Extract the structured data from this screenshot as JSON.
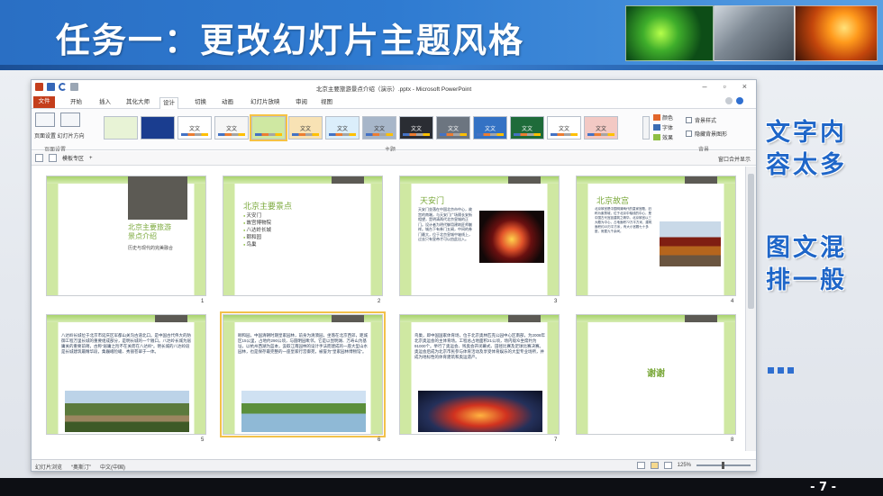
{
  "slide": {
    "title": "任务一：更改幻灯片主题风格",
    "page_number": "- 7 -",
    "annotations": {
      "text_content": [
        "文字内",
        "容太多"
      ],
      "layout": [
        "图文混",
        "排一般"
      ],
      "dots": "..."
    }
  },
  "ppt": {
    "window_title": "北京主要旅游景点介绍（演示）.pptx - Microsoft PowerPoint",
    "window_controls": [
      "–",
      "▫",
      "×"
    ],
    "tabs": [
      "文件",
      "开始",
      "插入",
      "其化大师",
      "设计",
      "切换",
      "动画",
      "幻灯片放映",
      "审阅",
      "视图"
    ],
    "active_tab": "设计",
    "ribbon": {
      "page_setup_label": "页面设置",
      "page_setup_buttons": "页面设置 幻灯片方向",
      "themes_label": "主题",
      "background_label": "背景",
      "theme_thumbs": [
        "",
        "",
        "文文",
        "文文",
        "",
        "文文",
        "文文",
        "文文",
        "文文",
        "文文",
        "文文",
        "文文",
        "文文",
        "文文",
        "文文"
      ],
      "variants": [
        {
          "label": "颜色",
          "color": "#e2662b"
        },
        {
          "label": "字体",
          "color": "#3b6db3"
        },
        {
          "label": "效果",
          "color": "#8fbf43"
        }
      ],
      "bg_options": [
        "背景样式",
        "隐藏背景图形"
      ]
    },
    "sorter": {
      "tabs": [
        "模板专区",
        "+"
      ],
      "merge_view": "窗口合并显示"
    },
    "slides": [
      {
        "num": "1",
        "title": "北京主要旅游\n景点介绍",
        "subtitle": "历史与现代的完美融合"
      },
      {
        "num": "2",
        "title": "北京主要景点",
        "bullets": [
          "天安门",
          "故宫博物院",
          "八达岭长城",
          "颐和园",
          "鸟巢"
        ]
      },
      {
        "num": "3",
        "title": "天安门",
        "body": "天安门坐落在中国北京市中心，故宫的南端，与天安门广场隔长安街相望，是明清两代北京皇城的正门。设计者为明代御用建筑匠师蒯祥。城台下有券门五阙，中间的券门最大，位于北京皇城中轴线上，过去只有皇帝才可以由此出入。"
      },
      {
        "num": "4",
        "title": "北京故宫",
        "body": "北京故宫是中国明清两代的皇家宫殿，旧称为紫禁城，位于北京中轴线的中心，是中国古代宫廷建筑之精华。北京故宫以三大殿为中心，占地面积72万平方米，建筑面积约15万平方米，有大小宫殿七十多座，房屋九千余间。"
      },
      {
        "num": "5",
        "title": "",
        "body": "八达岭长城位于北京市延庆区军都山关沟古道北口。是中国古代伟大的防御工程万里长城的重要组成部分，是明长城的一个隘口。八达岭长城为居庸关的重要前哨，古称“居庸之险不在关而在八达岭”。明长城的八达岭段是长城建筑最精华段，集巍峨险峻、秀丽苍翠于一体。"
      },
      {
        "num": "6",
        "title": "",
        "body": "颐和园，中国清朝时期皇家园林，前身为清漪园，坐落在北京西郊，距城区15公里，占地约290公顷，与圆明园毗邻。它是以昆明湖、万寿山为基址，以杭州西湖为蓝本，汲取江南园林的设计手法而建成的一座大型山水园林，也是保存最完整的一座皇家行宫御苑，被誉为“皇家园林博物馆”。"
      },
      {
        "num": "7",
        "title": "",
        "body": "鸟巢，即中国国家体育场，位于北京奥林匹克公园中心区南部，为2008年北京奥运会的主体育场。工程总占地面积21公顷，场内观众坐席约为91000个。举行了奥运会、残奥会开闭幕式、田径比赛及足球比赛决赛。奥运会后成为北京市民参与体育活动及享受体育娱乐的大型专业场所，并成为地标性的体育建筑和奥运遗产。"
      },
      {
        "num": "8",
        "title": "谢谢"
      }
    ],
    "status": {
      "view_label": "幻灯片浏览",
      "theme_name": "“奥斯汀”",
      "language": "中文(中国)",
      "zoom": "125%"
    }
  }
}
